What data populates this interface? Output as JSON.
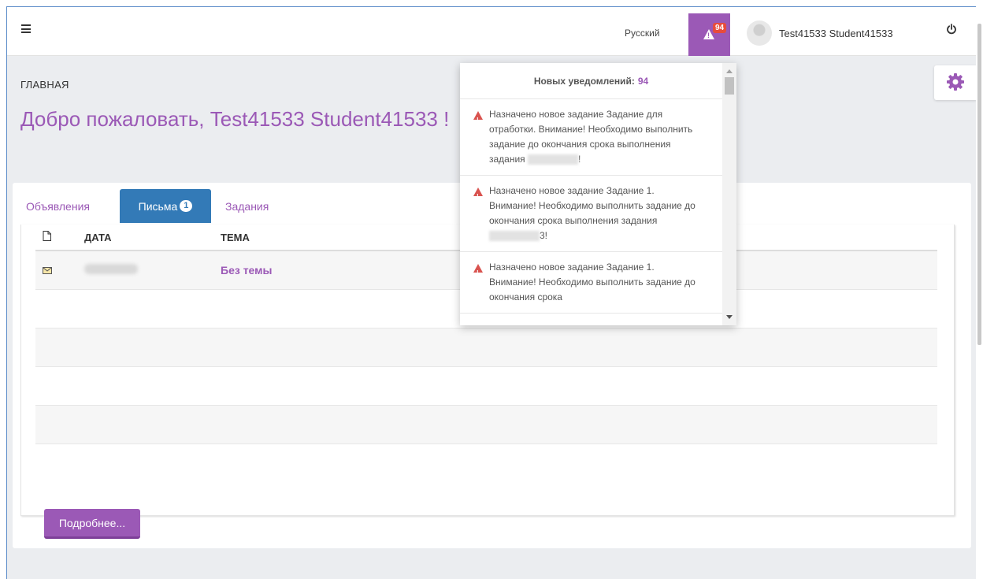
{
  "topbar": {
    "language": "Русский",
    "notification_count": "94",
    "user_name": "Test41533 Student41533"
  },
  "page": {
    "breadcrumb": "ГЛАВНАЯ",
    "welcome": "Добро пожаловать, Test41533 Student41533 !"
  },
  "tabs": {
    "announcements": "Объявления",
    "letters": "Письма",
    "letters_count": "1",
    "tasks": "Задания"
  },
  "table": {
    "headers": {
      "date": "ДАТА",
      "subject": "ТЕМА"
    },
    "rows": [
      {
        "subject": "Без темы"
      }
    ]
  },
  "more_button": "Подробнее...",
  "notifications": {
    "header_label": "Новых уведомлений:",
    "header_count": "94",
    "items": [
      {
        "text": "Назначено новое задание Задание для отработки. Внимание! Необходимо выполнить задание до окончания срока выполнения задания",
        "suffix": "!"
      },
      {
        "text": "Назначено новое задание Задание 1. Внимание! Необходимо выполнить задание до окончания срока выполнения задания",
        "suffix": "3!"
      },
      {
        "text": "Назначено новое задание Задание 1. Внимание! Необходимо выполнить задание до окончания срока"
      }
    ]
  },
  "icons": {
    "menu": "hamburger-icon",
    "alerts": "warning-icon",
    "power": "power-icon",
    "settings": "gear-icon",
    "file": "file-icon",
    "mail": "envelope-icon"
  },
  "colors": {
    "accent": "#9b59b6",
    "tab_active": "#337ab7",
    "badge": "#e74c3c",
    "alert": "#d9534f"
  }
}
